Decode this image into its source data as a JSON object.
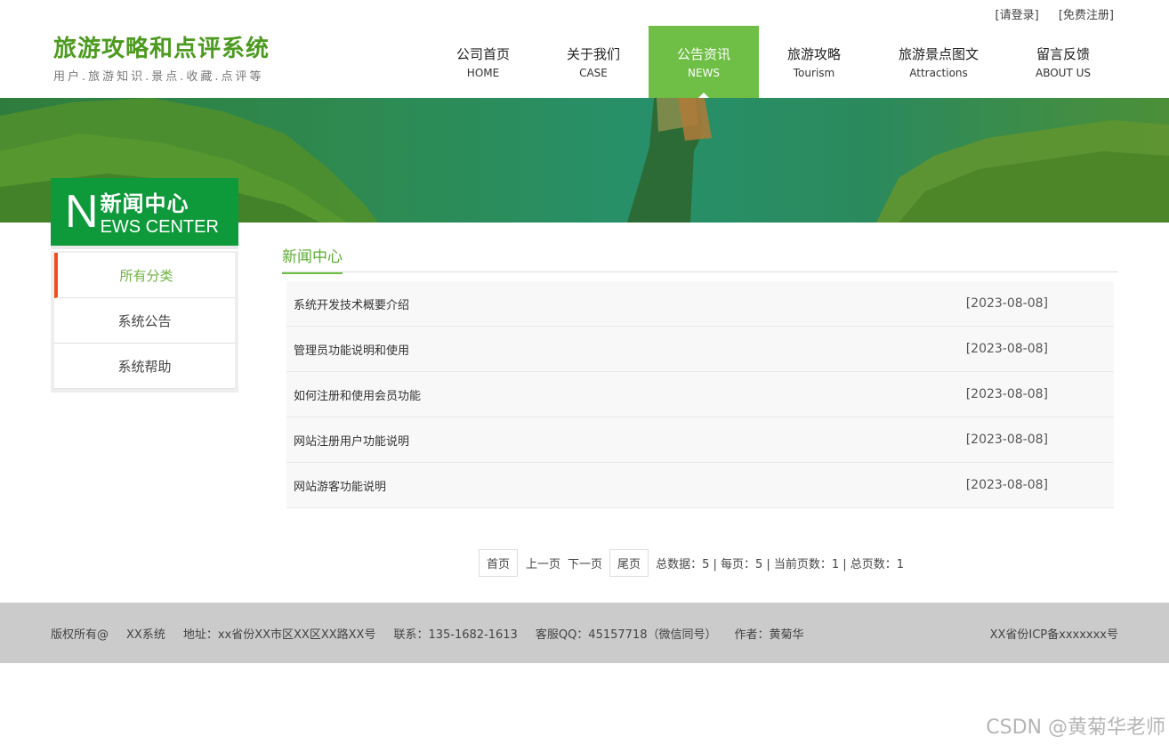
{
  "toplinks": {
    "login": "[请登录]",
    "register": "[免费注册]"
  },
  "logo": {
    "title": "旅游攻略和点评系统",
    "subtitle": "用户.旅游知识.景点.收藏.点评等"
  },
  "nav": [
    {
      "zh": "公司首页",
      "en": "HOME"
    },
    {
      "zh": "关于我们",
      "en": "CASE"
    },
    {
      "zh": "公告资讯",
      "en": "NEWS"
    },
    {
      "zh": "旅游攻略",
      "en": "Tourism"
    },
    {
      "zh": "旅游景点图文",
      "en": "Attractions"
    },
    {
      "zh": "留言反馈",
      "en": "ABOUT US"
    }
  ],
  "sidebar": {
    "badge_letter": "N",
    "badge_zh": "新闻中心",
    "badge_en": "EWS CENTER",
    "items": [
      "所有分类",
      "系统公告",
      "系统帮助"
    ]
  },
  "main": {
    "title": "新闻中心",
    "rows": [
      {
        "title": "系统开发技术概要介绍",
        "date": "[2023-08-08]"
      },
      {
        "title": "管理员功能说明和使用",
        "date": "[2023-08-08]"
      },
      {
        "title": "如何注册和使用会员功能",
        "date": "[2023-08-08]"
      },
      {
        "title": "网站注册用户功能说明",
        "date": "[2023-08-08]"
      },
      {
        "title": "网站游客功能说明",
        "date": "[2023-08-08]"
      }
    ]
  },
  "pager": {
    "first": "首页",
    "prev": "上一页",
    "next": "下一页",
    "last": "尾页",
    "info": "总数据：5 | 每页：5 | 当前页数：1 | 总页数：1"
  },
  "footer": {
    "copyright": "版权所有@",
    "company": "XX系统",
    "address": "地址：xx省份XX市区XX区XX路XX号",
    "phone": "联系：135-1682-1613",
    "qq": "客服QQ：45157718（微信同号）",
    "author": "作者：黄菊华",
    "icp": "XX省份ICP备xxxxxxx号"
  },
  "watermark": "CSDN @黄菊华老师",
  "colors": {
    "accent": "#6fbe45",
    "badge": "#0e9a3a",
    "active_marker": "#f04e1a"
  }
}
